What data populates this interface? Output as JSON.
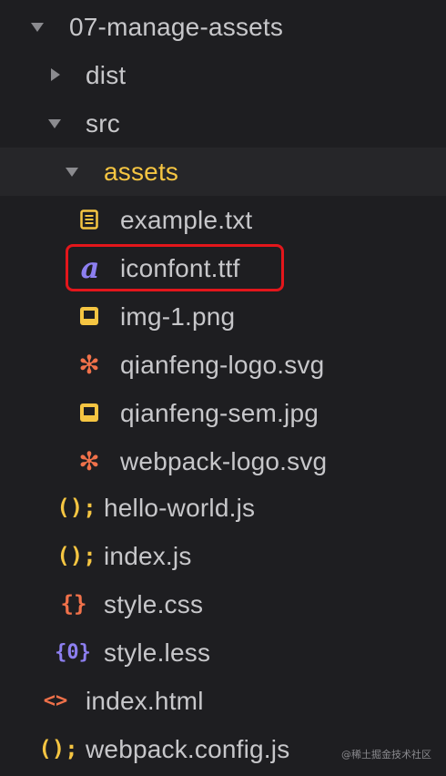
{
  "tree": {
    "root": {
      "label": "07-manage-assets",
      "expanded": true
    },
    "dist": {
      "label": "dist",
      "expanded": false
    },
    "src": {
      "label": "src",
      "expanded": true
    },
    "assets": {
      "label": "assets",
      "expanded": true
    },
    "files": {
      "example_txt": {
        "label": "example.txt",
        "icon": "text-file-icon"
      },
      "iconfont_ttf": {
        "label": "iconfont.ttf",
        "icon": "font-file-icon",
        "icon_glyph": "a"
      },
      "img_1_png": {
        "label": "img-1.png",
        "icon": "image-file-icon"
      },
      "qianfeng_logo_svg": {
        "label": "qianfeng-logo.svg",
        "icon": "svg-file-icon",
        "icon_glyph": "✻"
      },
      "qianfeng_sem_jpg": {
        "label": "qianfeng-sem.jpg",
        "icon": "image-file-icon"
      },
      "webpack_logo_svg": {
        "label": "webpack-logo.svg",
        "icon": "svg-file-icon",
        "icon_glyph": "✻"
      },
      "hello_world_js": {
        "label": "hello-world.js",
        "icon": "js-file-icon",
        "icon_glyph": "();"
      },
      "index_js": {
        "label": "index.js",
        "icon": "js-file-icon",
        "icon_glyph": "();"
      },
      "style_css": {
        "label": "style.css",
        "icon": "css-file-icon",
        "icon_glyph": "{}"
      },
      "style_less": {
        "label": "style.less",
        "icon": "less-file-icon",
        "icon_glyph": "{0}"
      },
      "index_html": {
        "label": "index.html",
        "icon": "html-file-icon",
        "icon_glyph": "<>"
      },
      "webpack_config_js": {
        "label": "webpack.config.js",
        "icon": "js-file-icon",
        "icon_glyph": "();"
      }
    }
  },
  "colors": {
    "background": "#1e1e21",
    "selected_row": "#262629",
    "text": "#c7c7ca",
    "active_folder": "#f5c542",
    "js_icon": "#f5c542",
    "css_icon": "#f0714a",
    "less_icon": "#8d7ff0",
    "html_icon": "#f0714a",
    "font_icon": "#8d7ff0",
    "image_icon": "#f5c542",
    "svg_icon": "#f0714a",
    "highlight": "#e3161b"
  },
  "watermark": "@稀土掘金技术社区"
}
